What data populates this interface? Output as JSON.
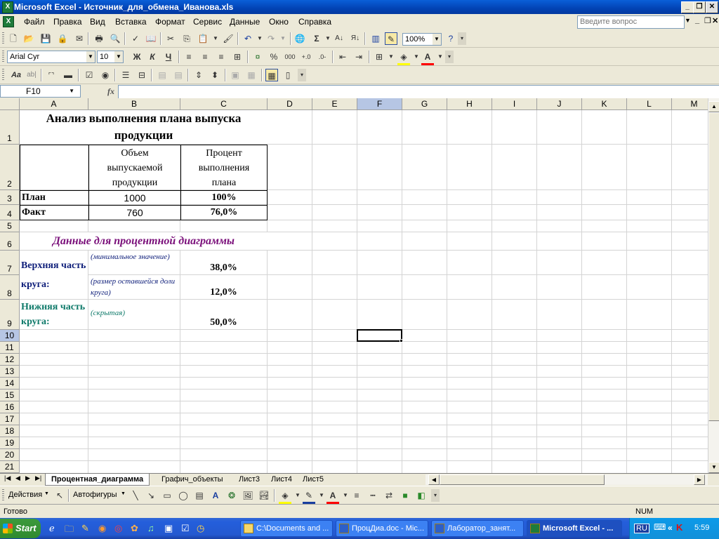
{
  "window": {
    "title": "Microsoft Excel - Источник_для_обмена_Иванова.xls"
  },
  "menu": [
    "Файл",
    "Правка",
    "Вид",
    "Вставка",
    "Формат",
    "Сервис",
    "Данные",
    "Окно",
    "Справка"
  ],
  "ask_placeholder": "Введите вопрос",
  "toolbar": {
    "zoom": "100%",
    "font": "Arial Cyr",
    "size": "10",
    "bold": "Ж",
    "italic": "К",
    "underline": "Ч",
    "percent": "%",
    "thousands": "000",
    "sigma": "Σ"
  },
  "formula_bar": {
    "name_box": "F10",
    "fx": "fx",
    "content": ""
  },
  "columns": [
    "A",
    "B",
    "C",
    "D",
    "E",
    "F",
    "G",
    "H",
    "I",
    "J",
    "K",
    "L",
    "M"
  ],
  "rows": [
    "1",
    "2",
    "3",
    "4",
    "5",
    "6",
    "7",
    "8",
    "9",
    "10",
    "11",
    "12",
    "13",
    "14",
    "15",
    "16",
    "17",
    "18",
    "19",
    "20",
    "21"
  ],
  "cells": {
    "title": "Анализ выполнения плана выпуска продукции",
    "hdr_volume": "Объем выпускаемой продукции",
    "hdr_percent": "Процент выполнения плана",
    "plan_label": "План",
    "plan_value": "1000",
    "plan_percent": "100%",
    "fact_label": "Факт",
    "fact_value": "760",
    "fact_percent": "76,0%",
    "diagram_title": "Данные для процентной диаграммы",
    "upper_label": "Верхняя часть круга:",
    "upper_note1": "(минимальное значение)",
    "upper_val1": "38,0%",
    "upper_note2": "(размер оставшейся доли круга)",
    "upper_val2": "12,0%",
    "lower_label": "Нижняя часть круга:",
    "lower_note": "(скрытая)",
    "lower_val": "50,0%"
  },
  "colors": {
    "purple": "#7a0f7a",
    "navy": "#0f1f7a",
    "teal": "#0f7a6a"
  },
  "tabs": [
    "Процентная_диаграмма",
    "Графич_объекты",
    "Лист3",
    "Лист4",
    "Лист5"
  ],
  "drawing": {
    "actions": "Действия",
    "autoshapes": "Автофигуры"
  },
  "status": {
    "ready": "Готово",
    "num": "NUM"
  },
  "taskbar": {
    "start": "Start",
    "tasks": [
      "C:\\Documents and ...",
      "ПроцДиа.doc - Mic...",
      "Лаборатор_занят...",
      "Microsoft Excel - ..."
    ],
    "lang": "RU",
    "clock": "5:59"
  }
}
